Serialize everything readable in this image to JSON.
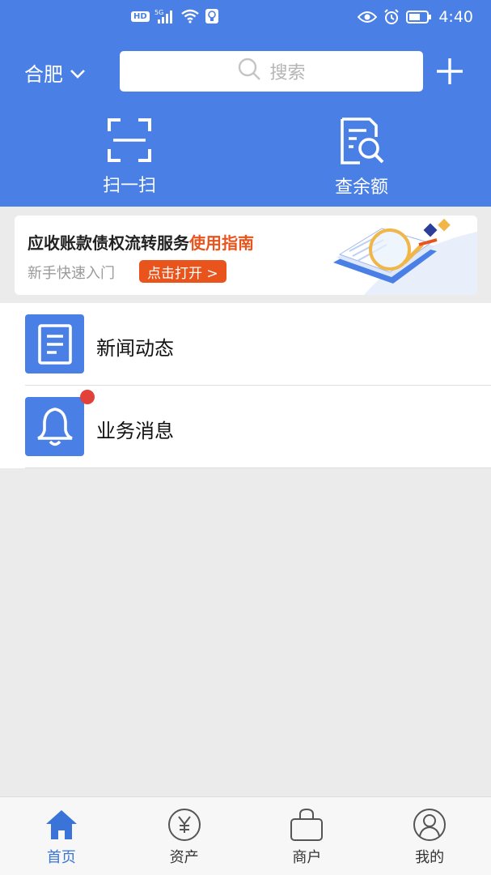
{
  "status_bar": {
    "hd": "HD",
    "network": "5G",
    "time": "4:40"
  },
  "header": {
    "city": "合肥",
    "search_placeholder": "搜索",
    "quick_actions": [
      {
        "label": "扫一扫",
        "icon": "scan-icon"
      },
      {
        "label": "查余额",
        "icon": "balance-query-icon"
      }
    ]
  },
  "banner": {
    "title_main": "应收账款债权流转服务",
    "title_highlight": "使用指南",
    "subtitle": "新手快速入门",
    "button": "点击打开 >"
  },
  "list": [
    {
      "label": "新闻动态",
      "icon": "news-document-icon",
      "has_badge": false
    },
    {
      "label": "业务消息",
      "icon": "bell-icon",
      "has_badge": true
    }
  ],
  "tabbar": {
    "items": [
      {
        "label": "首页",
        "icon": "home-icon",
        "active": true
      },
      {
        "label": "资产",
        "icon": "yuan-coin-icon",
        "active": false
      },
      {
        "label": "商户",
        "icon": "shopping-bag-icon",
        "active": false
      },
      {
        "label": "我的",
        "icon": "user-profile-icon",
        "active": false
      }
    ]
  },
  "colors": {
    "primary": "#4a7fe6",
    "accent": "#e8541c",
    "badge": "#e2413b",
    "tab_active": "#3b74d9"
  }
}
